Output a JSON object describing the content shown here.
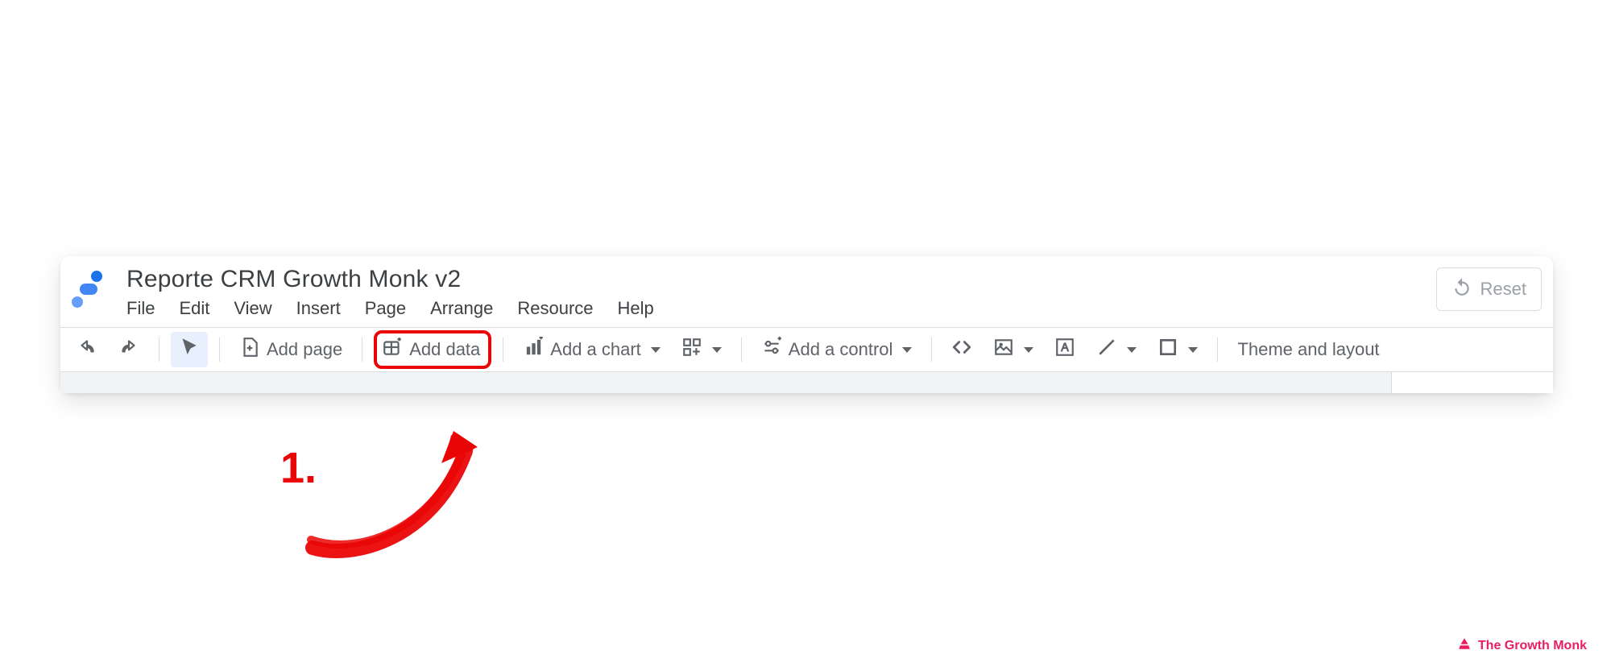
{
  "doc": {
    "title": "Reporte CRM Growth Monk v2"
  },
  "menubar": {
    "items": [
      "File",
      "Edit",
      "View",
      "Insert",
      "Page",
      "Arrange",
      "Resource",
      "Help"
    ]
  },
  "reset": {
    "label": "Reset"
  },
  "toolbar": {
    "add_page": "Add page",
    "add_data": "Add data",
    "add_chart": "Add a chart",
    "add_control": "Add a control",
    "theme_layout": "Theme and layout"
  },
  "annotation": {
    "number": "1."
  },
  "watermark": {
    "text": "The Growth Monk"
  }
}
